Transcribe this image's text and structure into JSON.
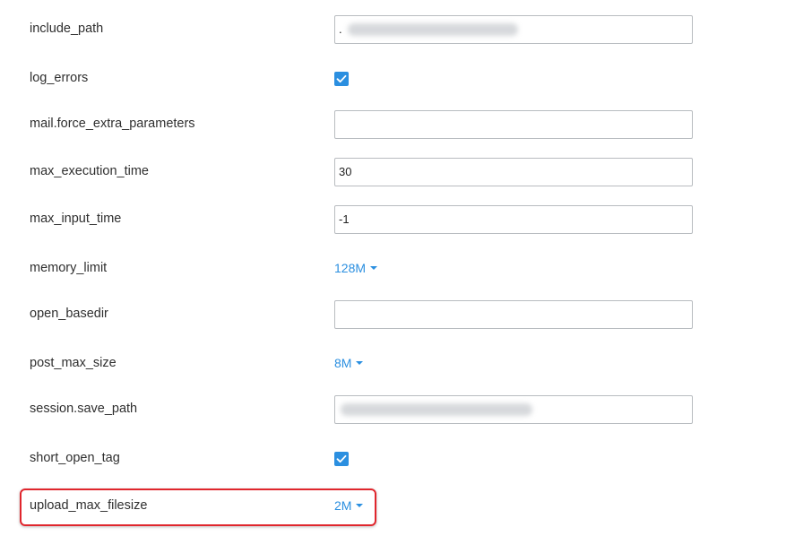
{
  "settings": [
    {
      "name": "include_path",
      "type": "text",
      "value": "."
    },
    {
      "name": "log_errors",
      "type": "checkbox",
      "checked": true
    },
    {
      "name": "mail.force_extra_parameters",
      "type": "text",
      "value": ""
    },
    {
      "name": "max_execution_time",
      "type": "text",
      "value": "30"
    },
    {
      "name": "max_input_time",
      "type": "text",
      "value": "-1"
    },
    {
      "name": "memory_limit",
      "type": "dropdown",
      "value": "128M"
    },
    {
      "name": "open_basedir",
      "type": "text",
      "value": ""
    },
    {
      "name": "post_max_size",
      "type": "dropdown",
      "value": "8M"
    },
    {
      "name": "session.save_path",
      "type": "text",
      "value": ""
    },
    {
      "name": "short_open_tag",
      "type": "checkbox",
      "checked": true
    },
    {
      "name": "upload_max_filesize",
      "type": "dropdown",
      "value": "2M",
      "highlighted": true
    }
  ],
  "colors": {
    "accent": "#2b8fe0",
    "highlight_border": "#e0262d",
    "input_border": "#b8bcc0"
  }
}
